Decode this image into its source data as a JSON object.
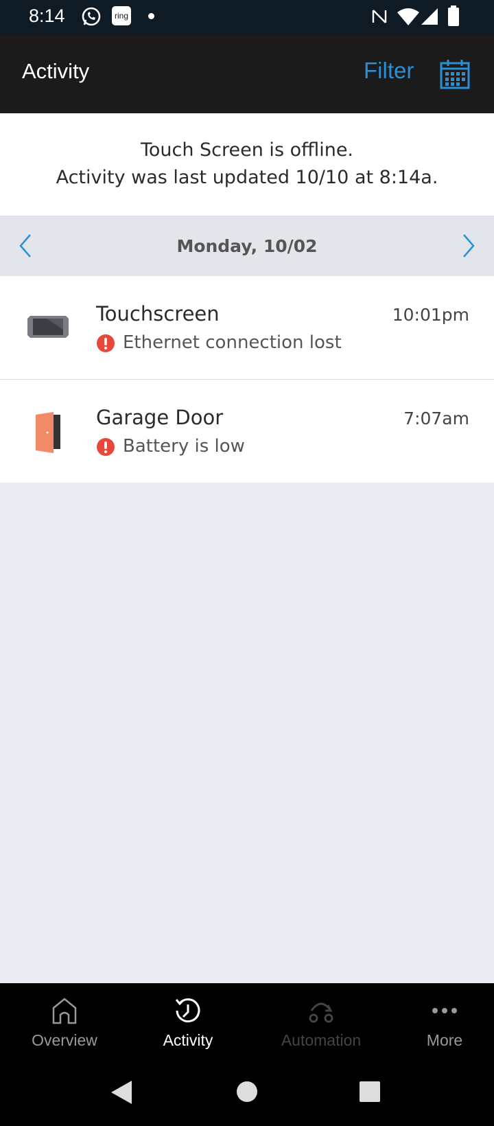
{
  "status_bar": {
    "time": "8:14",
    "app_icons": [
      "whatsapp-icon",
      "ring-icon",
      "dot-icon"
    ],
    "system_icons": [
      "nfc-icon",
      "wifi-icon",
      "signal-icon",
      "battery-icon"
    ],
    "ring_label": "ring"
  },
  "header": {
    "title": "Activity",
    "filter_label": "Filter",
    "calendar_icon": "calendar-icon",
    "accent_color": "#2a8fd6"
  },
  "offline_banner": {
    "line1": "Touch Screen is offline.",
    "line2": "Activity was last updated 10/10 at 8:14a."
  },
  "date_nav": {
    "date": "Monday, 10/02",
    "prev_icon": "chevron-left-icon",
    "next_icon": "chevron-right-icon"
  },
  "activities": [
    {
      "device": "Touchscreen",
      "time": "10:01pm",
      "event": "Ethernet connection lost",
      "icon": "touchscreen-icon",
      "status_icon": "alert-icon"
    },
    {
      "device": "Garage Door",
      "time": "7:07am",
      "event": "Battery is low",
      "icon": "door-icon",
      "status_icon": "alert-icon"
    }
  ],
  "bottom_nav": {
    "tabs": [
      {
        "label": "Overview",
        "icon": "home-icon",
        "state": "inactive"
      },
      {
        "label": "Activity",
        "icon": "history-icon",
        "state": "active"
      },
      {
        "label": "Automation",
        "icon": "automation-icon",
        "state": "disabled"
      },
      {
        "label": "More",
        "icon": "more-icon",
        "state": "inactive"
      }
    ]
  },
  "system_nav": [
    "back-icon",
    "home-button-icon",
    "recents-icon"
  ],
  "colors": {
    "alert": "#e8473a",
    "door": "#f28a68"
  }
}
